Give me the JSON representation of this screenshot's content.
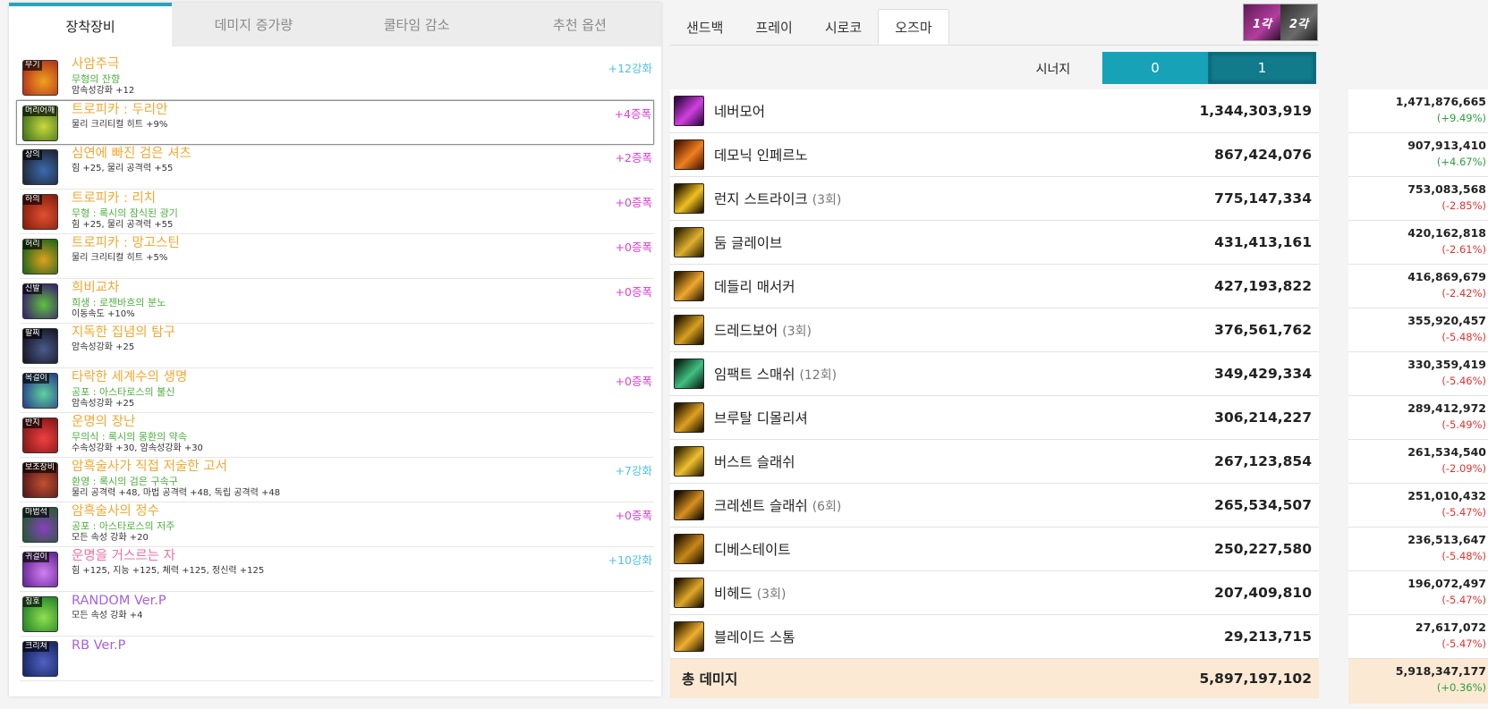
{
  "left": {
    "tabs": [
      "장착장비",
      "데미지 증가량",
      "쿨타임 감소",
      "추천 옵션"
    ],
    "items": [
      {
        "slot": "무기",
        "name": "사암주극",
        "name_style": "orange",
        "sub": "무형의 잔향",
        "stat": "암속성강화 +12",
        "badge": "+12강화",
        "badge_style": "blue",
        "icon_colors": [
          "#b83a1a",
          "#f0a020"
        ]
      },
      {
        "slot": "머리어깨",
        "name": "트로피카 : 두리안",
        "name_style": "orange",
        "sub": "",
        "stat": "물리 크리티컬 히트 +9%",
        "badge": "+4증폭",
        "badge_style": "magenta",
        "icon_colors": [
          "#4a7a1c",
          "#c8d840"
        ]
      },
      {
        "slot": "상의",
        "name": "심연에 빠진 검은 셔츠",
        "name_style": "orange",
        "sub": "",
        "stat": "힘 +25, 물리 공격력 +55",
        "badge": "+2증폭",
        "badge_style": "magenta",
        "icon_colors": [
          "#222a3a",
          "#3a6ab0"
        ]
      },
      {
        "slot": "하의",
        "name": "트로피카 : 리치",
        "name_style": "orange",
        "sub": "무형 : 록시의 잠식된 광기",
        "stat": "힘 +25, 물리 공격력 +55",
        "badge": "+0증폭",
        "badge_style": "magenta",
        "icon_colors": [
          "#8a2010",
          "#e05030"
        ]
      },
      {
        "slot": "허리",
        "name": "트로피카 : 망고스틴",
        "name_style": "orange",
        "sub": "",
        "stat": "물리 크리티컬 히트 +5%",
        "badge": "+0증폭",
        "badge_style": "magenta",
        "icon_colors": [
          "#2a6a1a",
          "#e0a020"
        ]
      },
      {
        "slot": "신발",
        "name": "희비교차",
        "name_style": "orange",
        "sub": "희생 : 로젠바흐의 분노",
        "stat": "이동속도 +10%",
        "badge": "+0증폭",
        "badge_style": "magenta",
        "icon_colors": [
          "#3a2a6a",
          "#60c040"
        ]
      },
      {
        "slot": "팔찌",
        "name": "지독한 집념의 탐구",
        "name_style": "orange",
        "sub": "",
        "stat": "암속성강화 +25",
        "badge": "",
        "badge_style": "blue",
        "icon_colors": [
          "#1a1a2a",
          "#4a5a8a"
        ]
      },
      {
        "slot": "목걸이",
        "name": "타락한 세계수의 생명",
        "name_style": "orange",
        "sub": "공포 : 아스타로스의 불신",
        "stat": "암속성강화 +25",
        "badge": "+0증폭",
        "badge_style": "magenta",
        "icon_colors": [
          "#2a4a8a",
          "#60d0a0"
        ]
      },
      {
        "slot": "반지",
        "name": "운명의 장난",
        "name_style": "orange",
        "sub": "무의식 : 록시의 몽환의 약속",
        "stat": "수속성강화 +30, 암속성강화 +30",
        "badge": "",
        "badge_style": "blue",
        "icon_colors": [
          "#8a1a1a",
          "#f04040"
        ]
      },
      {
        "slot": "보조장비",
        "name": "암흑술사가 직접 저술한 고서",
        "name_style": "orange",
        "sub": "환영 : 록시의 검은 구속구",
        "stat": "물리 공격력 +48, 마법 공격력 +48, 독립 공격력 +48",
        "badge": "+7강화",
        "badge_style": "blue",
        "icon_colors": [
          "#5a1a1a",
          "#c05030"
        ]
      },
      {
        "slot": "마법석",
        "name": "암흑술사의 정수",
        "name_style": "orange",
        "sub": "공포 : 아스타로스의 저주",
        "stat": "모든 속성 강화 +20",
        "badge": "+0증폭",
        "badge_style": "magenta",
        "icon_colors": [
          "#2a5a3a",
          "#8a40c0"
        ]
      },
      {
        "slot": "귀걸이",
        "name": "운명을 거스르는 자",
        "name_style": "pink",
        "sub": "",
        "stat": "힘 +125, 지능 +125, 체력 +125, 정신력 +125",
        "badge": "+10강화",
        "badge_style": "blue",
        "icon_colors": [
          "#6a2a9a",
          "#d080f0"
        ]
      },
      {
        "slot": "칭호",
        "name": "RANDOM Ver.P",
        "name_style": "purple",
        "sub": "",
        "stat": "모든 속성 강화 +4",
        "badge": "",
        "badge_style": "blue",
        "icon_colors": [
          "#2a8a2a",
          "#90e050"
        ]
      },
      {
        "slot": "크리쳐",
        "name": "RB Ver.P",
        "name_style": "purple",
        "sub": "",
        "stat": "",
        "badge": "",
        "badge_style": "blue",
        "icon_colors": [
          "#1a2a6a",
          "#5060c0"
        ]
      }
    ]
  },
  "char_tabs": [
    "샌드백",
    "프레이",
    "시로코",
    "오즈마"
  ],
  "thumb": {
    "label1": "1각",
    "label2": "2각"
  },
  "synergy": {
    "label": "시너지",
    "btn0": "0",
    "btn1": "1"
  },
  "skills": [
    {
      "name": "네버모어",
      "count": "",
      "damage": "1,344,303,919",
      "cmp": "1,471,876,665",
      "pct": "(+9.49%)",
      "dir": "up",
      "icon_colors": [
        "#3a0a4a",
        "#d040e0"
      ]
    },
    {
      "name": "데모닉 인페르노",
      "count": "",
      "damage": "867,424,076",
      "cmp": "907,913,410",
      "pct": "(+4.67%)",
      "dir": "up",
      "icon_colors": [
        "#5a1a00",
        "#f08020"
      ]
    },
    {
      "name": "런지 스트라이크",
      "count": "(3회)",
      "damage": "775,147,334",
      "cmp": "753,083,568",
      "pct": "(-2.85%)",
      "dir": "down",
      "icon_colors": [
        "#2a1a00",
        "#f0c020"
      ]
    },
    {
      "name": "둠 글레이브",
      "count": "",
      "damage": "431,413,161",
      "cmp": "420,162,818",
      "pct": "(-2.61%)",
      "dir": "down",
      "icon_colors": [
        "#3a2a00",
        "#e0b030"
      ]
    },
    {
      "name": "데들리 매서커",
      "count": "",
      "damage": "427,193,822",
      "cmp": "416,869,679",
      "pct": "(-2.42%)",
      "dir": "down",
      "icon_colors": [
        "#3a2200",
        "#f0a830"
      ]
    },
    {
      "name": "드레드보어",
      "count": "(3회)",
      "damage": "376,561,762",
      "cmp": "355,920,457",
      "pct": "(-5.48%)",
      "dir": "down",
      "icon_colors": [
        "#2a1a00",
        "#d8a020"
      ]
    },
    {
      "name": "임팩트 스매쉬",
      "count": "(12회)",
      "damage": "349,429,334",
      "cmp": "330,359,419",
      "pct": "(-5.46%)",
      "dir": "down",
      "icon_colors": [
        "#0a2a1a",
        "#40c080"
      ]
    },
    {
      "name": "브루탈 디몰리셔",
      "count": "",
      "damage": "306,214,227",
      "cmp": "289,412,972",
      "pct": "(-5.49%)",
      "dir": "down",
      "icon_colors": [
        "#2a1a00",
        "#e0a020"
      ]
    },
    {
      "name": "버스트 슬래쉬",
      "count": "",
      "damage": "267,123,854",
      "cmp": "261,534,540",
      "pct": "(-2.09%)",
      "dir": "down",
      "icon_colors": [
        "#3a2a00",
        "#f0c030"
      ]
    },
    {
      "name": "크레센트 슬래쉬",
      "count": "(6회)",
      "damage": "265,534,507",
      "cmp": "251,010,432",
      "pct": "(-5.47%)",
      "dir": "down",
      "icon_colors": [
        "#1a1000",
        "#d89020"
      ]
    },
    {
      "name": "디베스테이트",
      "count": "",
      "damage": "250,227,580",
      "cmp": "236,513,647",
      "pct": "(-5.48%)",
      "dir": "down",
      "icon_colors": [
        "#2a1800",
        "#c88818"
      ]
    },
    {
      "name": "비헤드",
      "count": "(3회)",
      "damage": "207,409,810",
      "cmp": "196,072,497",
      "pct": "(-5.47%)",
      "dir": "down",
      "icon_colors": [
        "#2a1a00",
        "#e0a828"
      ]
    },
    {
      "name": "블레이드 스톰",
      "count": "",
      "damage": "29,213,715",
      "cmp": "27,617,072",
      "pct": "(-5.47%)",
      "dir": "down",
      "icon_colors": [
        "#3a2400",
        "#f0b030"
      ]
    }
  ],
  "total": {
    "label": "총 데미지",
    "damage": "5,897,197,102",
    "cmp": "5,918,347,177",
    "pct": "(+0.36%)",
    "dir": "up"
  },
  "colors": {
    "accent": "#17a2b8",
    "accent_dark": "#117a8b",
    "item_orange": "#f3a833",
    "up": "#2e9e3c",
    "down": "#e0332f",
    "total_bg": "#fbe9d4"
  }
}
